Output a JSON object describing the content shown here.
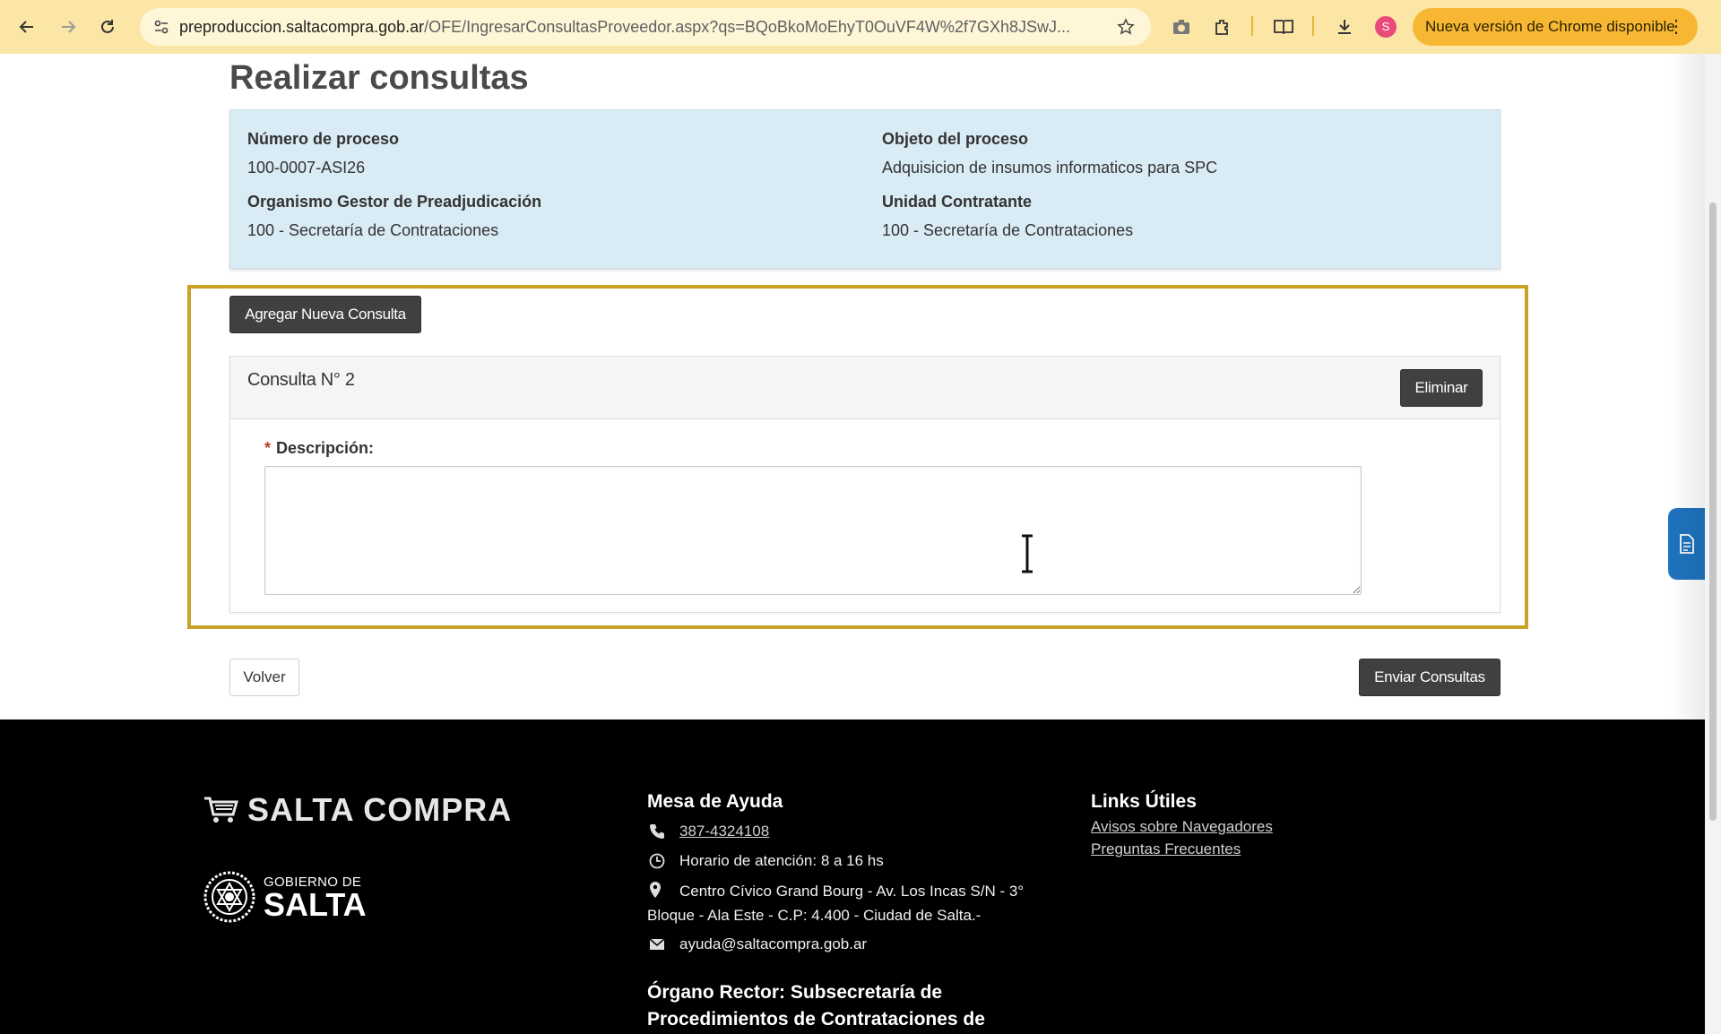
{
  "browser": {
    "url_host": "preproduccion.saltacompra.gob.ar",
    "url_path": "/OFE/IngresarConsultasProveedor.aspx?qs=BQoBkoMoEhyT0OuVF4W%2f7GXh8JSwJ...",
    "profile_initial": "S",
    "update_label": "Nueva versión de Chrome disponible",
    "colors": {
      "toolbar": "#fbe6a5",
      "update_pill": "#f7b733"
    }
  },
  "page": {
    "title": "Realizar consultas",
    "info": {
      "numero_label": "Número de proceso",
      "numero_value": "100-0007-ASI26",
      "objeto_label": "Objeto del proceso",
      "objeto_value": "Adquisicion de insumos informaticos para SPC",
      "organismo_label": "Organismo Gestor de Preadjudicación",
      "organismo_value": "100 - Secretaría de Contrataciones",
      "unidad_label": "Unidad Contratante",
      "unidad_value": "100 - Secretaría de Contrataciones"
    },
    "add_button": "Agregar Nueva Consulta",
    "consulta": {
      "title": "Consulta N° 2",
      "delete_button": "Eliminar",
      "required_mark": "*",
      "description_label": "Descripción:",
      "description_value": ""
    },
    "back_button": "Volver",
    "send_button": "Enviar Consultas",
    "highlight_color": "#c9a227"
  },
  "footer": {
    "brand": "SALTA COMPRA",
    "gov_small": "GOBIERNO DE",
    "gov_big": "SALTA",
    "help_heading": "Mesa de Ayuda",
    "phone": "387-4324108",
    "hours": "Horario de atención: 8 a 16 hs",
    "address": "Centro Cívico Grand Bourg - Av. Los Incas S/N - 3° Bloque - Ala Este - C.P: 4.400 - Ciudad de Salta.-",
    "email": "ayuda@saltacompra.gob.ar",
    "organo": "Órgano Rector: Subsecretaría de Procedimientos de Contrataciones de",
    "links_heading": "Links Útiles",
    "link_1": "Avisos sobre Navegadores",
    "link_2": "Preguntas Frecuentes"
  }
}
